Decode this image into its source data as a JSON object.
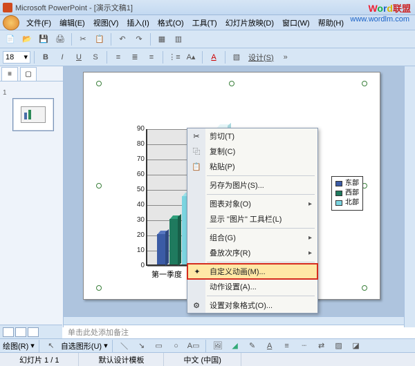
{
  "app": {
    "title": "Microsoft PowerPoint - [演示文稿1]"
  },
  "watermark": {
    "text_w": "W",
    "text_o": "o",
    "text_r": "r",
    "text_d": "d",
    "text_cn": "联盟",
    "url": "www.wordlm.com"
  },
  "menu": {
    "file": "文件(F)",
    "edit": "编辑(E)",
    "view": "视图(V)",
    "insert": "插入(I)",
    "format": "格式(O)",
    "tools": "工具(T)",
    "slideshow": "幻灯片放映(D)",
    "window": "窗口(W)",
    "help": "帮助(H)"
  },
  "toolbar2": {
    "font_size": "18",
    "design": "设计(S)"
  },
  "chart_data": {
    "type": "bar",
    "categories": [
      "第一季度"
    ],
    "series": [
      {
        "name": "东部",
        "values": [
          20
        ]
      },
      {
        "name": "西部",
        "values": [
          30
        ]
      },
      {
        "name": "北部",
        "values": [
          45
        ]
      }
    ],
    "extra_bar": {
      "name": "highlighted",
      "value": 90
    },
    "ylim": [
      0,
      90
    ],
    "yticks": [
      0,
      10,
      20,
      30,
      40,
      50,
      60,
      70,
      80,
      90
    ],
    "xlabel": "第一季度"
  },
  "legend": {
    "east": "东部",
    "west": "西部",
    "north": "北部"
  },
  "context_menu": {
    "cut": "剪切(T)",
    "copy": "复制(C)",
    "paste": "粘贴(P)",
    "save_as_pic": "另存为图片(S)...",
    "chart_object": "图表对象(O)",
    "show_pic_toolbar": "显示 \"图片\" 工具栏(L)",
    "group": "组合(G)",
    "order": "叠放次序(R)",
    "custom_anim": "自定义动画(M)...",
    "action": "动作设置(A)...",
    "format_obj": "设置对象格式(O)..."
  },
  "outline": {
    "slide_num": "1"
  },
  "notes": {
    "placeholder": "单击此处添加备注"
  },
  "draw_toolbar": {
    "draw": "绘图(R)",
    "autoshape": "自选图形(U)"
  },
  "status": {
    "slide": "幻灯片 1 / 1",
    "template": "默认设计模板",
    "lang": "中文 (中国)"
  }
}
